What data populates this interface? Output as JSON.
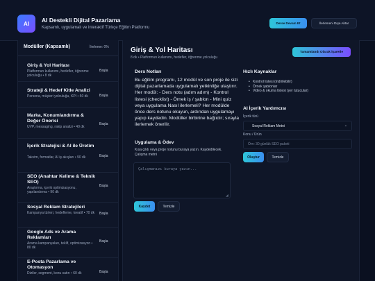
{
  "header": {
    "logo_text": "AI",
    "title": "AI Destekli Dijital Pazarlama",
    "subtitle": "Kapsamlı, uygulamalı ve interaktif Türkçe Eğitim Platformu",
    "continue_label": "Derse Devam Et",
    "export_label": "İlerlemeni Dışa Aktar"
  },
  "sidebar": {
    "title": "Modüller (Kapsamlı)",
    "progress": "İlerleme: 0%",
    "start_label": "Başla",
    "modules": [
      {
        "title": "Giriş & Yol Haritası",
        "desc": "Platformun kullanımı, hedefler, öğrenme yolculuğu • 8 dk"
      },
      {
        "title": "Strateji & Hedef Kitle Analizi",
        "desc": "Persona, müşteri yolculuğu, KPI • 50 dk"
      },
      {
        "title": "Marka, Konumlandırma & Değer Önerisi",
        "desc": "UVP, messaging, rakip analizi • 40 dk"
      },
      {
        "title": "İçerik Stratejisi & AI ile Üretim",
        "desc": "Takvim, formatlar, AI iş akışları • 90 dk"
      },
      {
        "title": "SEO (Anahtar Kelime & Teknik SEO)",
        "desc": "Araştırma, içerik optimizasyonu, yapılandırma • 90 dk"
      },
      {
        "title": "Sosyal Reklam Stratejileri",
        "desc": "Kampanya türleri, hedefleme, kreatif • 70 dk"
      },
      {
        "title": "Google Ads ve Arama Reklamları",
        "desc": "Arama kampanyaları, teklif, optimizasyon • 80 dk"
      },
      {
        "title": "E-Posta Pazarlama ve Otomasyon",
        "desc": "Diziler, segment, konu satırı • 60 dk"
      }
    ]
  },
  "lesson": {
    "title": "Giriş & Yol Haritası",
    "meta": "8 dk • Platformun kullanımı, hedefler, öğrenme yolculuğu",
    "complete_label": "Tamamlandı Olarak İşaretle",
    "notes_title": "Ders Notları",
    "notes_body": "Bu eğitim programı, 12 modül ve son proje ile sizi dijital pazarlamada uygulamalı yetkinliğe ulaştırır. Her modül: - Ders notu (adım adım) - Kontrol listesi (checklist) - Örnek iş / şablon - Mini quiz veya uygulama Nasıl ilerlemeli? Her modülde önce ders notunu okuyun, ardından uygulamayı yapıp kaydedin. Modüller birbirine bağlıdır; sırayla ilerlemek önerilir.",
    "homework_title": "Uygulama & Ödev",
    "homework_desc": "Kısa çıktı veya proje notunu buraya yazın. Kaydedilecek.",
    "homework_hint": "Çalışma metni",
    "homework_placeholder": "Çalışmanızı buraya yazın...",
    "save_label": "Kaydet",
    "clear_label": "Temizle"
  },
  "resources": {
    "title": "Hızlı Kaynaklar",
    "items": [
      "Kontrol listesi (indirilebilir)",
      "Örnek şablonlar",
      "Video & okuma listesi (yer tutucular)"
    ]
  },
  "ai": {
    "title": "AI İçerik Yardımcısı",
    "type_label": "İçerik türü",
    "type_value": "Sosyal Reklam Metni",
    "topic_label": "Konu / Ürün",
    "topic_placeholder": "Örn: 30 günlük SEO paketi",
    "generate_label": "Oluştur",
    "clear_label": "Temizle"
  }
}
